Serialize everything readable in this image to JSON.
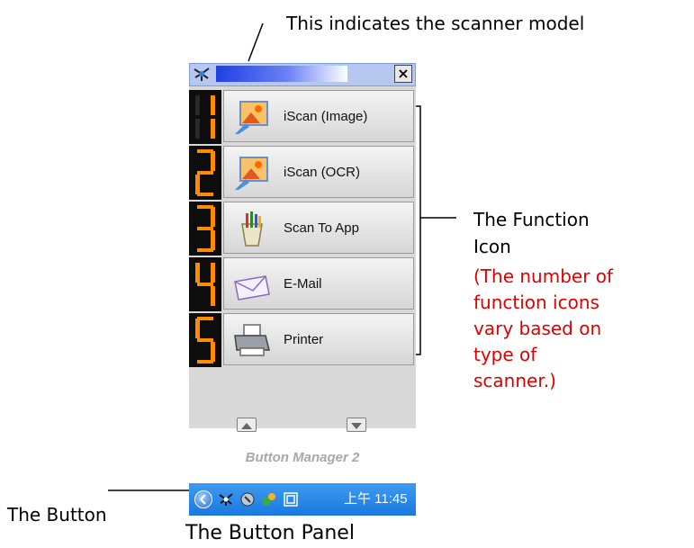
{
  "annotations": {
    "model": "This indicates the scanner model",
    "function_icon_line1": "The Function",
    "function_icon_line2": "Icon",
    "note_line1": "(The number of",
    "note_line2": "function icons",
    "note_line3": "vary based on",
    "note_line4": "type of",
    "note_line5": "scanner.)",
    "button": "The Button",
    "caption": "The Button Panel"
  },
  "panel": {
    "close_label": "×",
    "functions": [
      {
        "number": "1",
        "label": "iScan (Image)",
        "icon": "image-scan-icon"
      },
      {
        "number": "2",
        "label": "iScan (OCR)",
        "icon": "ocr-scan-icon"
      },
      {
        "number": "3",
        "label": "Scan To App",
        "icon": "app-icon"
      },
      {
        "number": "4",
        "label": "E-Mail",
        "icon": "envelope-icon"
      },
      {
        "number": "5",
        "label": "Printer",
        "icon": "printer-icon"
      }
    ],
    "brand": "Button Manager 2"
  },
  "taskbar": {
    "clock": "上午 11:45"
  },
  "colors": {
    "digit": "#ff8c00",
    "note": "#e00000",
    "taskbar": "#1a78e0"
  }
}
